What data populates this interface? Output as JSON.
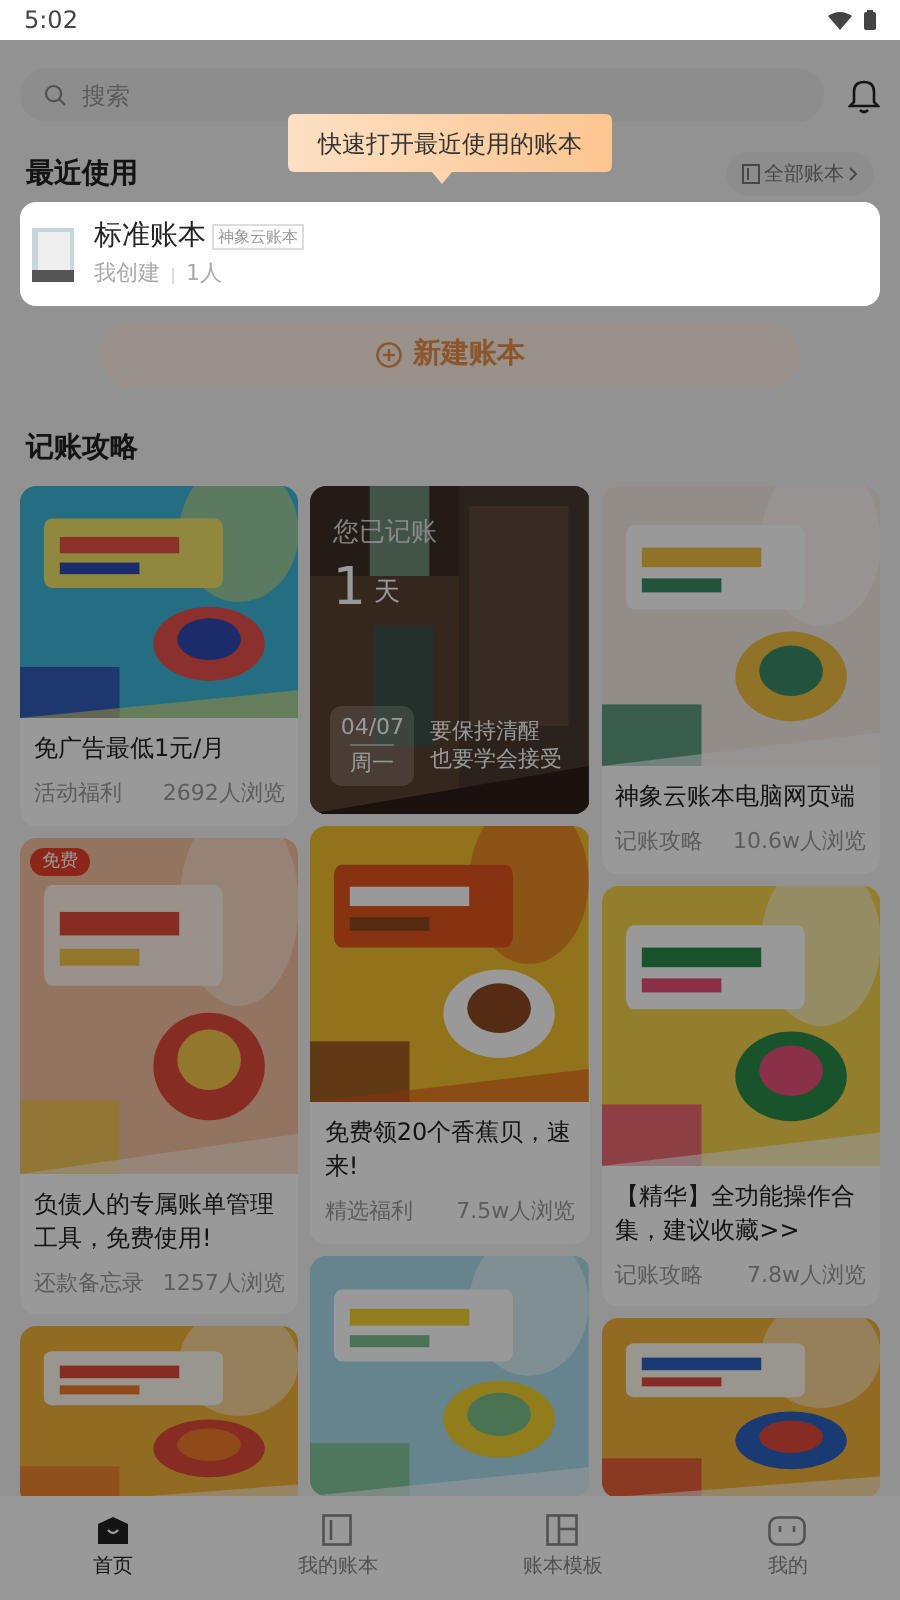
{
  "status_bar": {
    "time": "5:02"
  },
  "search": {
    "placeholder": "搜索"
  },
  "tooltip": {
    "text": "快速打开最近使用的账本"
  },
  "recent": {
    "title": "最近使用",
    "all_button": "全部账本",
    "book": {
      "name": "标准账本",
      "tag": "神象云账本",
      "creator": "我创建",
      "members": "1人"
    }
  },
  "new_book_button": {
    "label": "新建账本"
  },
  "guides": {
    "title": "记账攻略",
    "columns": [
      [
        {
          "kind": "article",
          "title": "免广告最低1元/月",
          "category": "活动福利",
          "views": "2692人浏览"
        },
        {
          "kind": "article",
          "badge": "免费",
          "title": "负债人的专属账单管理工具，免费使用!",
          "category": "还款备忘录",
          "views": "1257人浏览"
        },
        {
          "kind": "picture"
        }
      ],
      [
        {
          "kind": "diary",
          "label": "您已记账",
          "days": "1",
          "unit": "天",
          "date": "04/07",
          "weekday": "周一",
          "quote_lines": [
            "要保持清醒",
            "也要学会接受"
          ]
        },
        {
          "kind": "article",
          "title": "免费领20个香蕉贝，速来!",
          "category": "精选福利",
          "views": "7.5w人浏览"
        },
        {
          "kind": "picture"
        }
      ],
      [
        {
          "kind": "article",
          "title": "神象云账本电脑网页端",
          "category": "记账攻略",
          "views": "10.6w人浏览"
        },
        {
          "kind": "article",
          "title": "【精华】全功能操作合集，建议收藏>>",
          "category": "记账攻略",
          "views": "7.8w人浏览"
        },
        {
          "kind": "picture"
        }
      ]
    ]
  },
  "bottom_nav": [
    {
      "label": "首页",
      "selected": true
    },
    {
      "label": "我的账本",
      "selected": false
    },
    {
      "label": "账本模板",
      "selected": false
    },
    {
      "label": "我的",
      "selected": false
    }
  ]
}
